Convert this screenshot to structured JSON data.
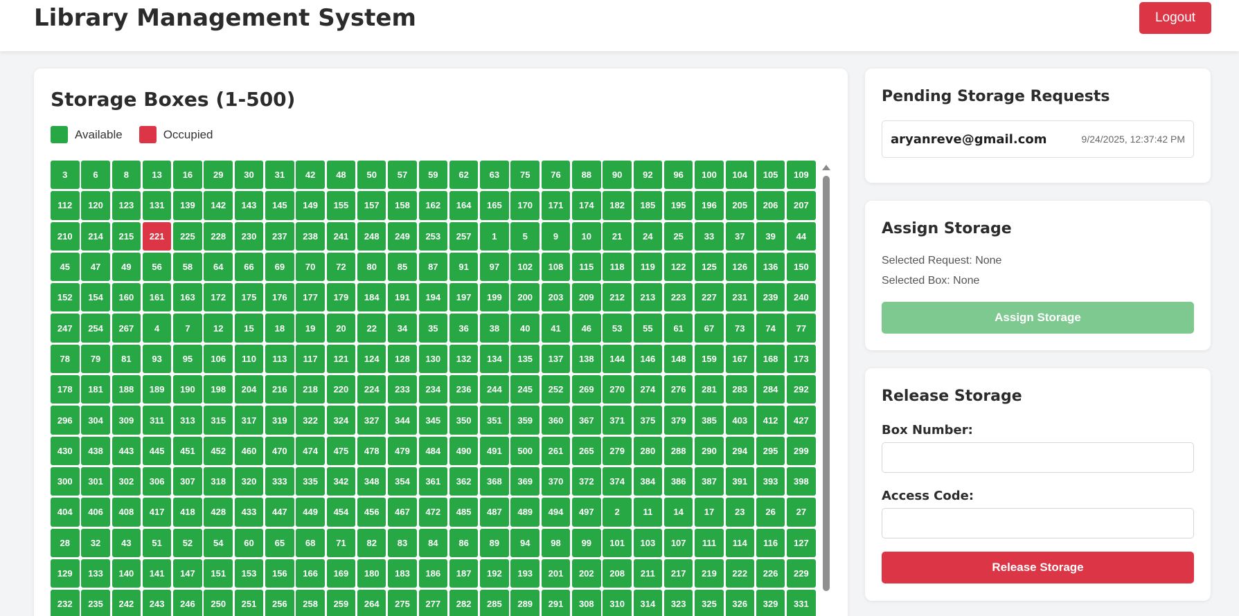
{
  "header": {
    "title": "Library Management System",
    "logout_label": "Logout"
  },
  "storage": {
    "title": "Storage Boxes (1-500)",
    "legend": [
      {
        "label": "Available",
        "color": "#28a745"
      },
      {
        "label": "Occupied",
        "color": "#dc3545"
      }
    ],
    "boxes": [
      3,
      6,
      8,
      13,
      16,
      29,
      30,
      31,
      42,
      48,
      50,
      57,
      59,
      62,
      63,
      75,
      76,
      88,
      90,
      92,
      96,
      100,
      104,
      105,
      109,
      112,
      120,
      123,
      131,
      139,
      142,
      143,
      145,
      149,
      155,
      157,
      158,
      162,
      164,
      165,
      170,
      171,
      174,
      182,
      185,
      195,
      196,
      205,
      206,
      207,
      210,
      214,
      215,
      221,
      225,
      228,
      230,
      237,
      238,
      241,
      248,
      249,
      253,
      257,
      1,
      5,
      9,
      10,
      21,
      24,
      25,
      33,
      37,
      39,
      44,
      45,
      47,
      49,
      56,
      58,
      64,
      66,
      69,
      70,
      72,
      80,
      85,
      87,
      91,
      97,
      102,
      108,
      115,
      118,
      119,
      122,
      125,
      126,
      136,
      150,
      152,
      154,
      160,
      161,
      163,
      172,
      175,
      176,
      177,
      179,
      184,
      191,
      194,
      197,
      199,
      200,
      203,
      209,
      212,
      213,
      223,
      227,
      231,
      239,
      240,
      247,
      254,
      267,
      4,
      7,
      12,
      15,
      18,
      19,
      20,
      22,
      34,
      35,
      36,
      38,
      40,
      41,
      46,
      53,
      55,
      61,
      67,
      73,
      74,
      77,
      78,
      79,
      81,
      93,
      95,
      106,
      110,
      113,
      117,
      121,
      124,
      128,
      130,
      132,
      134,
      135,
      137,
      138,
      144,
      146,
      148,
      159,
      167,
      168,
      173,
      178,
      181,
      188,
      189,
      190,
      198,
      204,
      216,
      218,
      220,
      224,
      233,
      234,
      236,
      244,
      245,
      252,
      269,
      270,
      274,
      276,
      281,
      283,
      284,
      292,
      296,
      304,
      309,
      311,
      313,
      315,
      317,
      319,
      322,
      324,
      327,
      344,
      345,
      350,
      351,
      359,
      360,
      367,
      371,
      375,
      379,
      385,
      403,
      412,
      427,
      430,
      438,
      443,
      445,
      451,
      452,
      460,
      470,
      474,
      475,
      478,
      479,
      484,
      490,
      491,
      500,
      261,
      265,
      279,
      280,
      288,
      290,
      294,
      295,
      299,
      300,
      301,
      302,
      306,
      307,
      318,
      320,
      333,
      335,
      342,
      348,
      354,
      361,
      362,
      368,
      369,
      370,
      372,
      374,
      384,
      386,
      387,
      391,
      393,
      398,
      404,
      406,
      408,
      417,
      418,
      428,
      433,
      447,
      449,
      454,
      456,
      467,
      472,
      485,
      487,
      489,
      494,
      497,
      2,
      11,
      14,
      17,
      23,
      26,
      27,
      28,
      32,
      43,
      51,
      52,
      54,
      60,
      65,
      68,
      71,
      82,
      83,
      84,
      86,
      89,
      94,
      98,
      99,
      101,
      103,
      107,
      111,
      114,
      116,
      127,
      129,
      133,
      140,
      141,
      147,
      151,
      153,
      156,
      166,
      169,
      180,
      183,
      186,
      187,
      192,
      193,
      201,
      202,
      208,
      211,
      217,
      219,
      222,
      226,
      229,
      232,
      235,
      242,
      243,
      246,
      250,
      251,
      256,
      258,
      259,
      264,
      275,
      277,
      282,
      285,
      289,
      291,
      308,
      310,
      314,
      323,
      325,
      326,
      329,
      331
    ],
    "occupied": [
      221
    ]
  },
  "pending": {
    "title": "Pending Storage Requests",
    "requests": [
      {
        "email": "aryanreve@gmail.com",
        "time": "9/24/2025, 12:37:42 PM"
      }
    ]
  },
  "assign": {
    "title": "Assign Storage",
    "selected_request": "Selected Request: None",
    "selected_box": "Selected Box: None",
    "button_label": "Assign Storage"
  },
  "release": {
    "title": "Release Storage",
    "box_label": "Box Number:",
    "box_value": "",
    "code_label": "Access Code:",
    "code_value": "",
    "button_label": "Release Storage"
  }
}
